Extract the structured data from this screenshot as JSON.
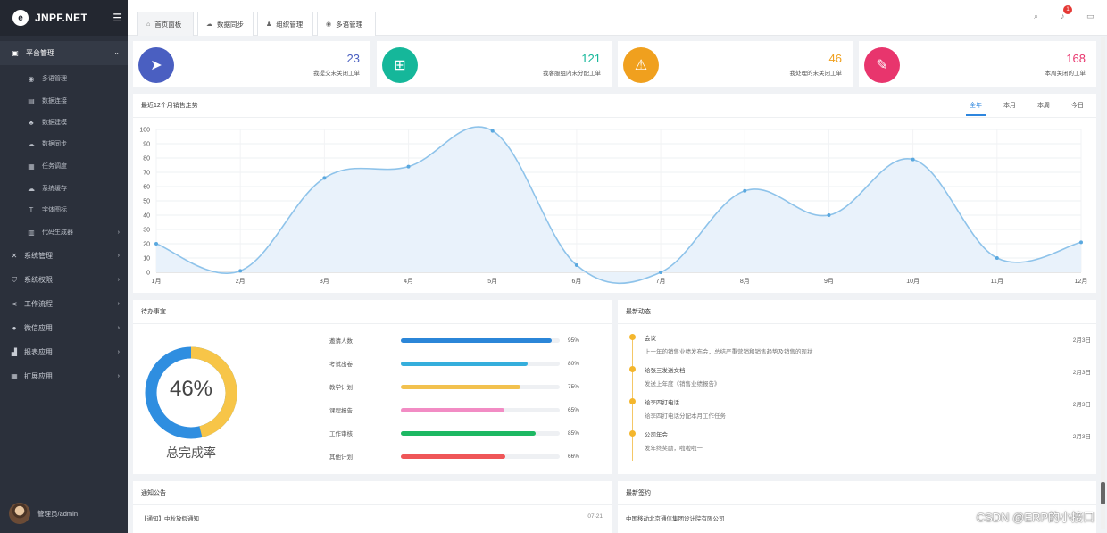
{
  "brand": {
    "name": "JNPF.NET"
  },
  "sidebar": {
    "group": {
      "label": "平台管理"
    },
    "items": [
      {
        "label": "多语管理",
        "icon": "globe-icon"
      },
      {
        "label": "数据连接",
        "icon": "database-icon"
      },
      {
        "label": "数据建模",
        "icon": "sitemap-icon"
      },
      {
        "label": "数据同步",
        "icon": "cloud-sync-icon"
      },
      {
        "label": "任务调度",
        "icon": "schedule-icon"
      },
      {
        "label": "系统缓存",
        "icon": "cache-icon"
      },
      {
        "label": "字体图标",
        "icon": "font-icon"
      },
      {
        "label": "代码生成器",
        "icon": "code-gen-icon"
      }
    ],
    "groups": [
      {
        "label": "系统管理",
        "icon": "tools-icon"
      },
      {
        "label": "系统权限",
        "icon": "shield-icon"
      },
      {
        "label": "工作流程",
        "icon": "share-icon"
      },
      {
        "label": "微信应用",
        "icon": "wechat-icon"
      },
      {
        "label": "报表应用",
        "icon": "bar-chart-icon"
      },
      {
        "label": "扩展应用",
        "icon": "grid-icon"
      }
    ],
    "user": "管理员/admin"
  },
  "tabs": [
    {
      "label": "首页面板",
      "icon": "home-icon"
    },
    {
      "label": "数据同步",
      "icon": "cloud-icon"
    },
    {
      "label": "组织管理",
      "icon": "user-icon"
    },
    {
      "label": "多语管理",
      "icon": "globe-icon"
    }
  ],
  "toolbar": {
    "notify_count": "1"
  },
  "stats": [
    {
      "value": "23",
      "label": "我提交未关闭工单",
      "color": "#4a5fc1",
      "icon": "paper-plane-icon"
    },
    {
      "value": "121",
      "label": "我客服组内未分配工单",
      "color": "#15b79a",
      "icon": "org-tree-icon"
    },
    {
      "value": "46",
      "label": "我处理的未关闭工单",
      "color": "#f0a01e",
      "icon": "warning-icon"
    },
    {
      "value": "168",
      "label": "本周关闭的工单",
      "color": "#e8356d",
      "icon": "edit-icon"
    }
  ],
  "sales": {
    "title": "最近12个月销售走势",
    "ranges": [
      "全年",
      "本月",
      "本周",
      "今日"
    ],
    "active_range": "全年"
  },
  "chart_data": {
    "type": "area",
    "title": "最近12个月销售走势",
    "categories": [
      "1月",
      "2月",
      "3月",
      "4月",
      "5月",
      "6月",
      "7月",
      "8月",
      "9月",
      "10月",
      "11月",
      "12月"
    ],
    "series": [
      {
        "values": [
          20,
          1,
          66,
          74,
          99,
          5,
          0,
          57,
          40,
          79,
          10,
          21
        ]
      }
    ],
    "ylim": [
      0,
      100
    ],
    "yticks": [
      0,
      10,
      20,
      30,
      40,
      50,
      60,
      70,
      80,
      90,
      100
    ],
    "grid": true,
    "color": "#8ec3ea",
    "fill": "#e9f2fb"
  },
  "todo": {
    "title": "待办事宜",
    "percent": "46%",
    "percent_value": 0.46,
    "caption": "总完成率",
    "items": [
      {
        "label": "邀请人数",
        "value": "95%",
        "pct": 0.95,
        "color": "#2b86d8"
      },
      {
        "label": "考试出卷",
        "value": "80%",
        "pct": 0.8,
        "color": "#35aedc"
      },
      {
        "label": "教学计划",
        "value": "75%",
        "pct": 0.75,
        "color": "#f2c14e"
      },
      {
        "label": "课程报告",
        "value": "65%",
        "pct": 0.65,
        "color": "#f28cc4"
      },
      {
        "label": "工作审核",
        "value": "85%",
        "pct": 0.85,
        "color": "#1db863"
      },
      {
        "label": "其他计划",
        "value": "66%",
        "pct": 0.66,
        "color": "#ef5658"
      }
    ],
    "ring_colors": {
      "done": "#f7c548",
      "rest": "#2f8ee0"
    }
  },
  "news": {
    "title": "最新动态",
    "items": [
      {
        "title": "会议",
        "desc": "上一年的销售业绩发布会，总结严重营销和销售趋势及销售的现状",
        "date": "2月3日"
      },
      {
        "title": "给张三发送文档",
        "desc": "发送上年度《销售业绩报告》",
        "date": "2月3日"
      },
      {
        "title": "给李四打电话",
        "desc": "给李四打电话分配本月工作任务",
        "date": "2月3日"
      },
      {
        "title": "公司年会",
        "desc": "发年终奖励，啦啦啦一",
        "date": "2月3日"
      }
    ]
  },
  "notice": {
    "title": "通知公告",
    "items": [
      {
        "title": "【通知】中秋放假通知",
        "date": "07-21"
      }
    ]
  },
  "contracts": {
    "title": "最新签约",
    "items": [
      {
        "title": "中国移动北京通信集团设计院有限公司"
      }
    ]
  },
  "watermark": "CSDN @ERP的小接口"
}
